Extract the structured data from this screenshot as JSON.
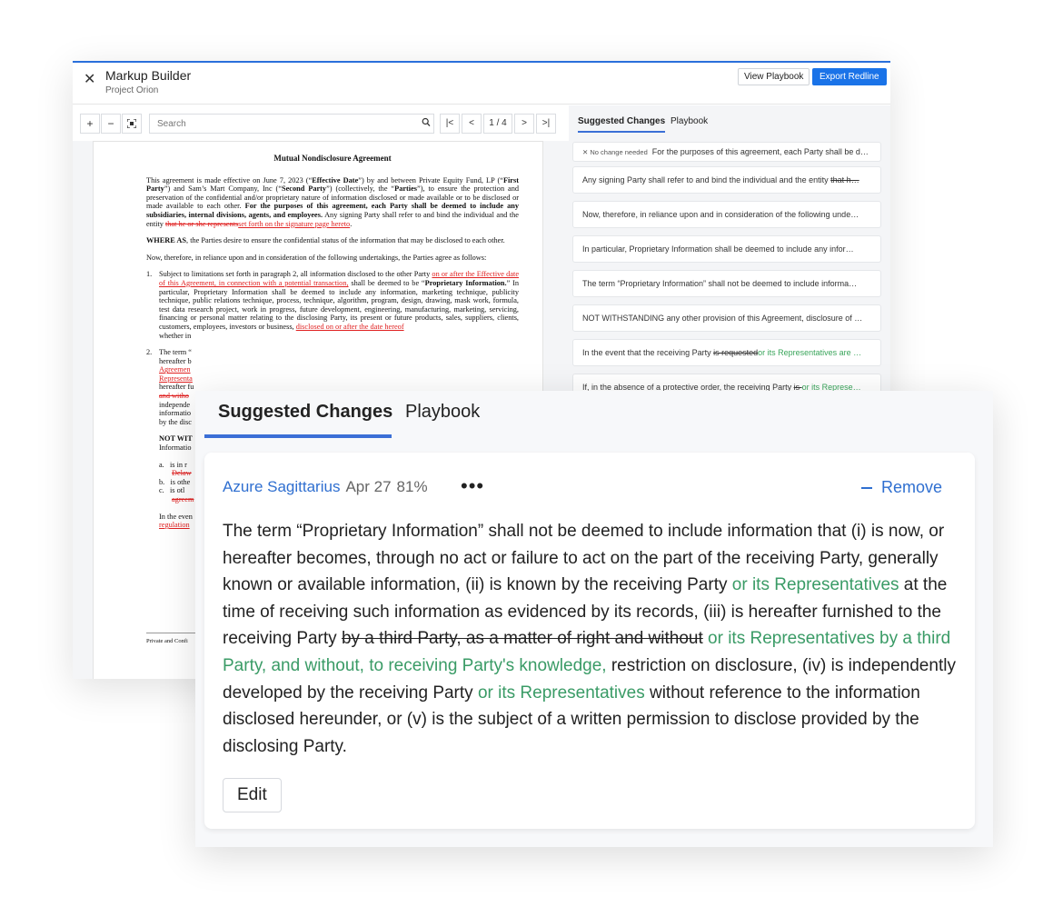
{
  "app": {
    "title": "Markup Builder",
    "subtitle": "Project Orion",
    "view_playbook_label": "View Playbook",
    "export_label": "Export Redline",
    "accent_color": "#1a73e8"
  },
  "toolbar": {
    "zoom_in": "+",
    "zoom_out": "−",
    "search_placeholder": "Search",
    "page_indicator": "1 / 4",
    "first_label": "|<",
    "prev_label": "<",
    "next_label": ">",
    "last_label": ">|"
  },
  "document": {
    "title": "Mutual Nondisclosure Agreement",
    "p1_a": "This agreement is made effective on June 7, 2023 (“",
    "p1_effective": "Effective Date",
    "p1_b": "”) by and between Private Equity Fund, LP (“",
    "p1_first": "First Party",
    "p1_c": "”) and Sam’s Mart Company, Inc (“",
    "p1_second": "Second Party",
    "p1_d": "”) (collectively, the “",
    "p1_parties": "Parties",
    "p1_e": "”), to ensure the protection and preservation of the confidential and/or proprietary nature of information disclosed or made available or to be disclosed or made available to each other. ",
    "p1_bold": "For the purposes of this agreement, each Party shall be deemed to include any subsidiaries, internal divisions, agents, and employees.",
    "p1_f": " Any signing Party shall refer to and bind the individual and the entity ",
    "p1_del": "that he or she represents",
    "p1_ins": "set forth on the signature page hereto",
    "p1_end": ".",
    "p2_bold": "WHERE AS",
    "p2_text": ", the Parties desire to ensure the confidential status of the information that may be disclosed to each other.",
    "p3": "Now, therefore, in reliance upon and in consideration of the following undertakings, the Parties agree as follows:",
    "item1_num": "1.",
    "item1_a": "Subject to limitations set forth in paragraph 2, all information disclosed to the other Party ",
    "item1_ins": "on or after the Effective date of this Agreement, in connection with a potential transaction,",
    "item1_b": " shall be deemed to be “",
    "item1_bold": "Proprietary Information.",
    "item1_c": "” In particular, Proprietary Information shall be deemed to include any information, marketing technique, publicity technique, public relations technique, process, technique, algorithm, program, design, drawing, mask work, formula, test data research project, work in progress, future development, engineering, manufacturing, marketing, servicing, financing or personal matter relating to the disclosing Party, its present or future products, sales, suppliers, clients, customers, employees, investors or business, ",
    "item1_ins2": "disclosed on or after the date hereof",
    "item1_d": " whether in",
    "item2_num": "2.",
    "item2_l1": "The term “",
    "item2_l2": "hereafter b",
    "item2_l3": "Agreemen",
    "item2_l4": "Representa",
    "item2_l5": "hereafter fu",
    "item2_l6": "and witho",
    "item2_l7": "independe",
    "item2_l8": "informatio",
    "item2_l9": "by the disc",
    "not_wit": "NOT WIT",
    "not_wit_l2": "Informatio",
    "a_num": "a.",
    "a_text": "is in r",
    "a_del": "Delaw",
    "b_num": "b.",
    "b_text": "is othe",
    "c_num": "c.",
    "c_text": "is otl",
    "c_del": "agreem",
    "event_l1": "In the even",
    "event_l2": "regulation",
    "footer": "Private and Confi"
  },
  "side_panel": {
    "tab_suggested": "Suggested Changes",
    "tab_playbook": "Playbook",
    "no_change_label": "No change needed",
    "cards": [
      {
        "text": "For the purposes of this agreement, each Party shall be dee…"
      },
      {
        "text": "Any signing Party shall refer to and bind the individual and the entity ",
        "strike": "that h…"
      },
      {
        "text": "Now, therefore, in reliance upon and in consideration of the following unde…"
      },
      {
        "text": "In particular, Proprietary Information shall be deemed to include any infor…"
      },
      {
        "text": "The term “Proprietary Information” shall not be deemed to include informa…"
      },
      {
        "text": "NOT WITHSTANDING any other provision of this Agreement, disclosure of …"
      },
      {
        "text": "In the event that the receiving Party ",
        "strike": "is requested",
        "green": "or its Representatives are …"
      },
      {
        "text": "If, in the absence of a protective order, the receiving Party ",
        "strike": "is ",
        "green": "or its Represe…"
      }
    ]
  },
  "overlay": {
    "tab_suggested": "Suggested Changes",
    "tab_playbook": "Playbook",
    "author": "Azure Sagittarius",
    "date": "Apr 27",
    "confidence": "81%",
    "more": "•••",
    "remove_label": "Remove",
    "t1": "The term “Proprietary Information” shall not be deemed to include information that (i) is now, or hereafter becomes, through no act or failure to act on the part of the receiving Party, generally known or available information, (ii) is known by the receiving Party ",
    "ins1": "or its Representatives",
    "t2": " at the time of receiving such information as evidenced by its records, (iii) is hereafter furnished to the receiving Party ",
    "del1": "by a third Party, as a matter of right and without",
    "t3": " ",
    "ins2": "or its Representatives by a third Party, and without, to receiving Party's knowledge,",
    "t4": " restriction on disclosure, (iv) is independently developed by the receiving Party ",
    "ins3": "or its Representatives",
    "t5": " without reference to the information disclosed hereunder, or (v) is the subject of a written permission to disclose provided by the disclosing Party.",
    "edit_label": "Edit",
    "insert_color": "#3a9b66"
  }
}
